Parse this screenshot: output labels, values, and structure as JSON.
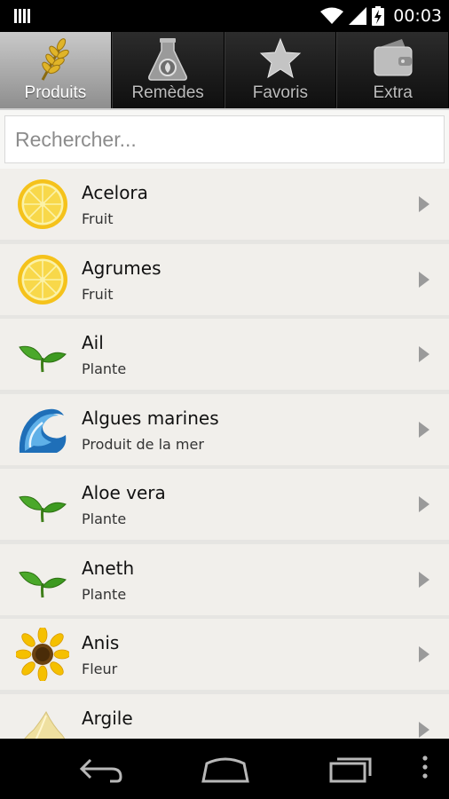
{
  "status_bar": {
    "time": "00:03"
  },
  "tabs": [
    {
      "label": "Produits",
      "icon": "wheat-icon",
      "active": true
    },
    {
      "label": "Remèdes",
      "icon": "flask-icon",
      "active": false
    },
    {
      "label": "Favoris",
      "icon": "star-icon",
      "active": false
    },
    {
      "label": "Extra",
      "icon": "wallet-icon",
      "active": false
    }
  ],
  "search": {
    "placeholder": "Rechercher..."
  },
  "items": [
    {
      "name": "Acelora",
      "category": "Fruit",
      "icon": "lemon-icon"
    },
    {
      "name": "Agrumes",
      "category": "Fruit",
      "icon": "lemon-icon"
    },
    {
      "name": "Ail",
      "category": "Plante",
      "icon": "leaf-icon"
    },
    {
      "name": "Algues marines",
      "category": "Produit de la mer",
      "icon": "wave-icon"
    },
    {
      "name": "Aloe vera",
      "category": "Plante",
      "icon": "leaf-icon"
    },
    {
      "name": "Aneth",
      "category": "Plante",
      "icon": "leaf-icon"
    },
    {
      "name": "Anis",
      "category": "Fleur",
      "icon": "sunflower-icon"
    },
    {
      "name": "Argile",
      "category": "",
      "icon": "clay-icon"
    }
  ]
}
